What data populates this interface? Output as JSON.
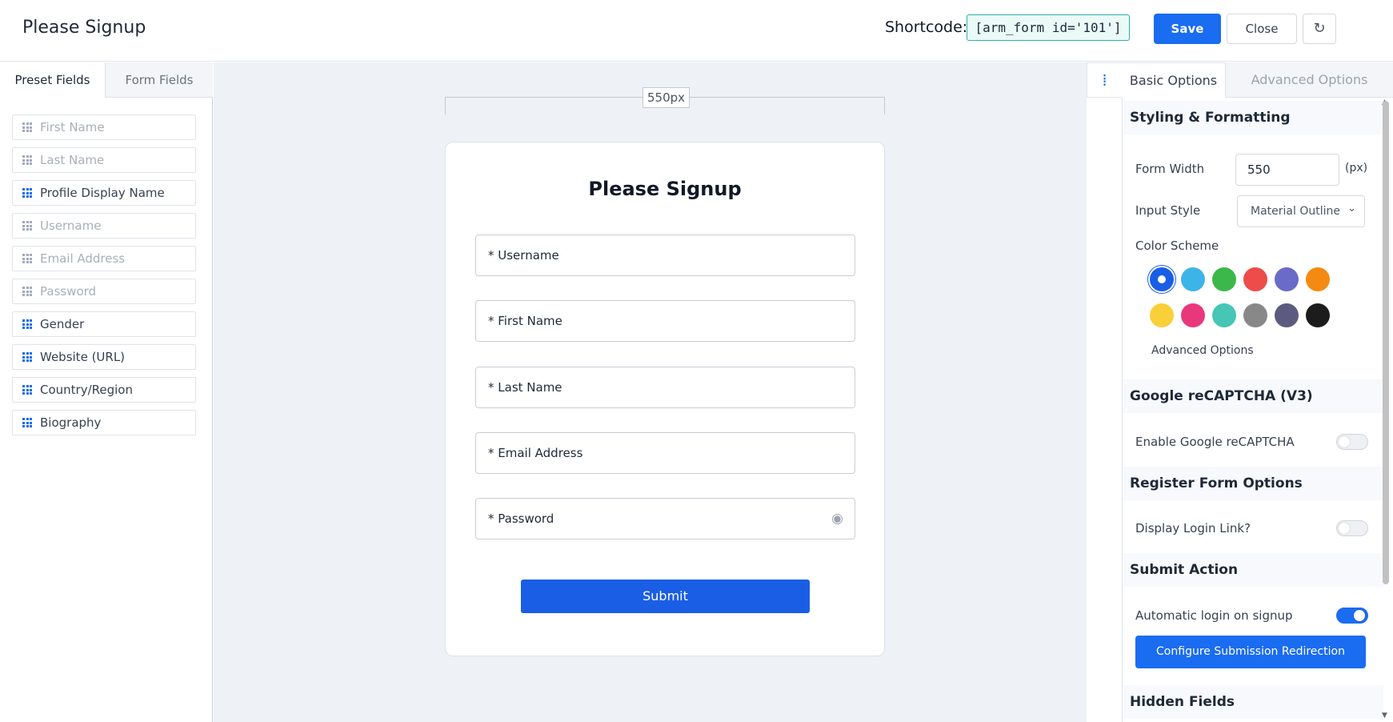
{
  "header": {
    "title": "Please Signup",
    "shortcode_label": "Shortcode:",
    "shortcode_value": "[arm_form id='101']",
    "save_label": "Save",
    "close_label": "Close",
    "reset_icon": "↻"
  },
  "left_panel": {
    "tabs": [
      {
        "label": "Preset Fields",
        "active": true
      },
      {
        "label": "Form Fields",
        "active": false
      }
    ],
    "fields": [
      {
        "label": "First Name",
        "enabled": false
      },
      {
        "label": "Last Name",
        "enabled": false
      },
      {
        "label": "Profile Display Name",
        "enabled": true
      },
      {
        "label": "Username",
        "enabled": false
      },
      {
        "label": "Email Address",
        "enabled": false
      },
      {
        "label": "Password",
        "enabled": false
      },
      {
        "label": "Gender",
        "enabled": true
      },
      {
        "label": "Website (URL)",
        "enabled": true
      },
      {
        "label": "Country/Region",
        "enabled": true
      },
      {
        "label": "Biography",
        "enabled": true
      }
    ]
  },
  "canvas": {
    "ruler_label": "550px",
    "form": {
      "title": "Please Signup",
      "inputs": [
        "* Username",
        "* First Name",
        "* Last Name",
        "* Email Address",
        "* Password"
      ],
      "eye_icon": "◉",
      "submit_label": "Submit"
    }
  },
  "right_panel": {
    "handle_icon": "⁞",
    "tabs": [
      {
        "label": "Basic Options",
        "active": true
      },
      {
        "label": "Advanced Options",
        "active": false
      }
    ],
    "styling": {
      "heading": "Styling & Formatting",
      "form_width_label": "Form Width",
      "form_width_value": "550",
      "form_width_unit": "(px)",
      "input_style_label": "Input Style",
      "input_style_value": "Material Outline",
      "select_arrow": "⌄",
      "color_scheme_label": "Color Scheme",
      "colors": [
        "#1a5ee6",
        "#3db4e8",
        "#3cb84a",
        "#ee4b4b",
        "#6a6ac8",
        "#f58a12",
        "#f9cf3a",
        "#e9387a",
        "#47c6b5",
        "#888888",
        "#5c5a7e",
        "#1c1c1c"
      ],
      "selected_color_index": 0,
      "advanced_options_link": "Advanced Options"
    },
    "recaptcha": {
      "heading": "Google reCAPTCHA (V3)",
      "enable_label": "Enable Google reCAPTCHA",
      "enabled": false
    },
    "register_options": {
      "heading": "Register Form Options",
      "login_link_label": "Display Login Link?",
      "login_link_enabled": false
    },
    "submit_action": {
      "heading": "Submit Action",
      "auto_login_label": "Automatic login on signup",
      "auto_login_enabled": true,
      "configure_button": "Configure Submission Redirection"
    },
    "hidden_fields": {
      "heading": "Hidden Fields"
    }
  }
}
